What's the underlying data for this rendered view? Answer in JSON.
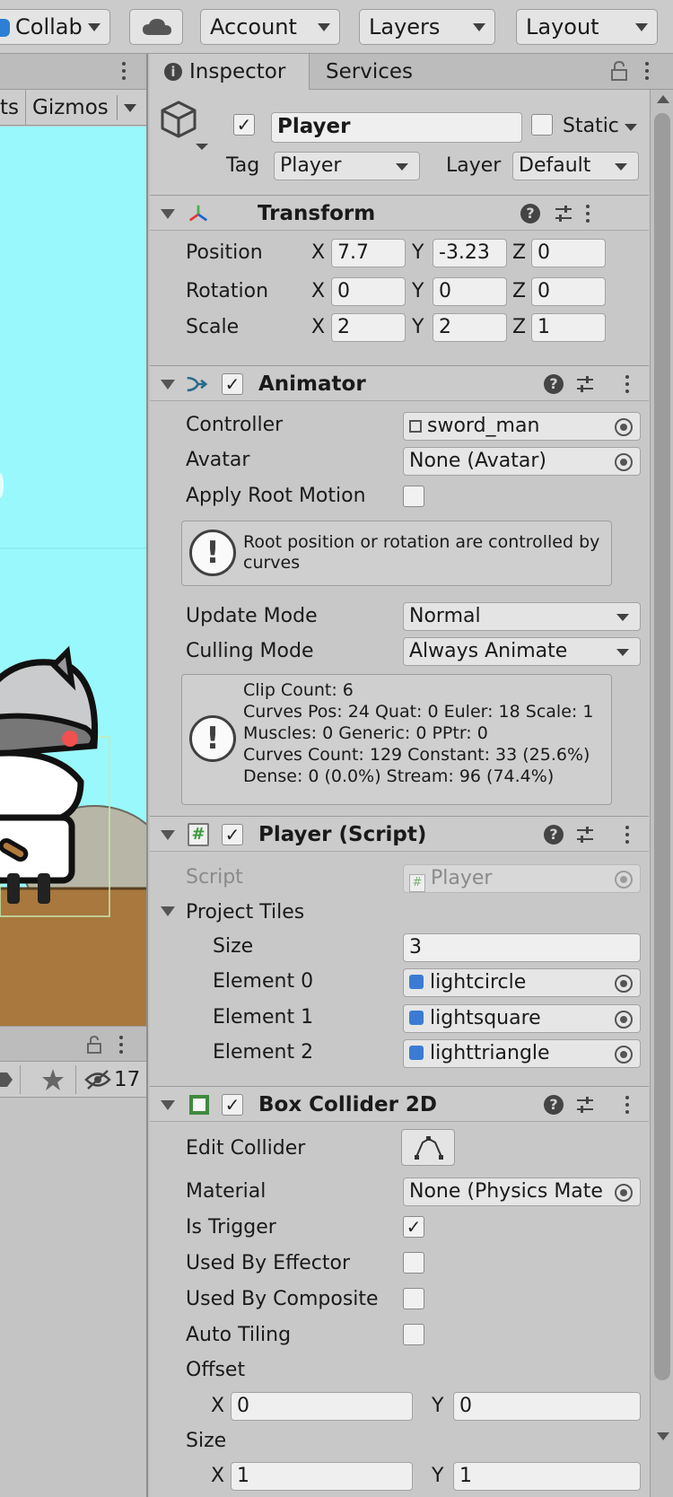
{
  "toolbar": {
    "collab": "Collab",
    "account": "Account",
    "layers": "Layers",
    "layout": "Layout"
  },
  "scene": {
    "tab_partial": "ts",
    "gizmos": "Gizmos",
    "visibility_count": "17",
    "sky_color": "#99f8fb",
    "ground_color": "#a8783e"
  },
  "inspector": {
    "tab_inspector": "Inspector",
    "tab_services": "Services",
    "object": {
      "name": "Player",
      "static_label": "Static",
      "tag_label": "Tag",
      "tag_value": "Player",
      "layer_label": "Layer",
      "layer_value": "Default"
    },
    "transform": {
      "title": "Transform",
      "position_label": "Position",
      "rotation_label": "Rotation",
      "scale_label": "Scale",
      "x": "X",
      "y": "Y",
      "z": "Z",
      "position": {
        "x": "7.7",
        "y": "-3.23",
        "z": "0"
      },
      "rotation": {
        "x": "0",
        "y": "0",
        "z": "0"
      },
      "scale": {
        "x": "2",
        "y": "2",
        "z": "1"
      }
    },
    "animator": {
      "title": "Animator",
      "controller_label": "Controller",
      "controller_value": "sword_man",
      "avatar_label": "Avatar",
      "avatar_value": "None (Avatar)",
      "apply_root_motion_label": "Apply Root Motion",
      "help_line1": "Root position or rotation are controlled by",
      "help_line2": "curves",
      "update_mode_label": "Update Mode",
      "update_mode_value": "Normal",
      "culling_mode_label": "Culling Mode",
      "culling_mode_value": "Always Animate",
      "stats": [
        "Clip Count: 6",
        "Curves Pos: 24 Quat: 0 Euler: 18 Scale: 1",
        "Muscles: 0 Generic: 0 PPtr: 0",
        "Curves Count: 129 Constant: 33 (25.6%)",
        "Dense: 0 (0.0%) Stream: 96 (74.4%)"
      ]
    },
    "player_script": {
      "title": "Player (Script)",
      "script_label": "Script",
      "script_value": "Player",
      "project_tiles_label": "Project Tiles",
      "size_label": "Size",
      "size_value": "3",
      "elements": [
        {
          "label": "Element 0",
          "value": "lightcircle"
        },
        {
          "label": "Element 1",
          "value": "lightsquare"
        },
        {
          "label": "Element 2",
          "value": "lighttriangle"
        }
      ]
    },
    "box_collider": {
      "title": "Box Collider 2D",
      "edit_collider_label": "Edit Collider",
      "material_label": "Material",
      "material_value": "None (Physics Mate",
      "is_trigger_label": "Is Trigger",
      "used_by_effector_label": "Used By Effector",
      "used_by_composite_label": "Used By Composite",
      "auto_tiling_label": "Auto Tiling",
      "offset_label": "Offset",
      "offset_x": "0",
      "offset_y": "0",
      "size_label": "Size",
      "size_x": "1",
      "size_y": "1"
    }
  }
}
